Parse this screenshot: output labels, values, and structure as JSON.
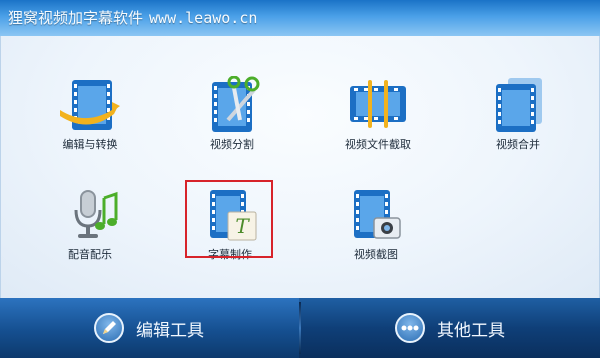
{
  "window": {
    "title": "狸窝视频加字幕软件",
    "url": "www.leawo.cn"
  },
  "tools": [
    {
      "label": "编辑与转换",
      "icon": "film-convert-icon"
    },
    {
      "label": "视频分割",
      "icon": "film-scissors-icon"
    },
    {
      "label": "视频文件截取",
      "icon": "film-strip-icon"
    },
    {
      "label": "视频合并",
      "icon": "film-merge-icon"
    },
    {
      "label": "配音配乐",
      "icon": "microphone-music-icon"
    },
    {
      "label": "字幕制作",
      "icon": "film-subtitle-icon"
    },
    {
      "label": "视频截图",
      "icon": "film-camera-icon"
    }
  ],
  "selected_tool": "字幕制作",
  "bottom_tabs": [
    {
      "label": "编辑工具",
      "icon": "pencil-icon",
      "active": true
    },
    {
      "label": "其他工具",
      "icon": "more-dots-icon",
      "active": false
    }
  ],
  "colors": {
    "accent": "#1b73c7",
    "selection": "#d7232a",
    "bottom_bar": "#0f3f78"
  }
}
